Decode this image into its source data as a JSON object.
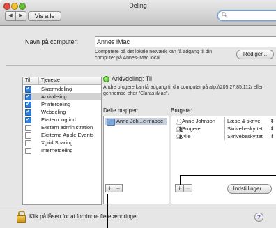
{
  "window": {
    "title": "Deling"
  },
  "toolbar": {
    "back_icon": "◀",
    "forward_icon": "▶",
    "show_all_label": "Vis alle",
    "search_value": ""
  },
  "computer": {
    "name_label": "Navn på computer:",
    "name_value": "Annes iMac",
    "description": "Computere på det lokale netværk kan få adgang til din computer på Annes-iMac.local",
    "edit_button": "Rediger..."
  },
  "services": {
    "header_on": "Til",
    "header_service": "Tjeneste",
    "items": [
      {
        "label": "Skærmdeling",
        "checked": true,
        "selected": false
      },
      {
        "label": "Arkivdeling",
        "checked": true,
        "selected": true
      },
      {
        "label": "Printerdeling",
        "checked": true,
        "selected": false
      },
      {
        "label": "Webdeling",
        "checked": true,
        "selected": false
      },
      {
        "label": "Ekstern log ind",
        "checked": true,
        "selected": false
      },
      {
        "label": "Ekstern administration",
        "checked": false,
        "selected": false
      },
      {
        "label": "Eksterne Apple Events",
        "checked": false,
        "selected": false
      },
      {
        "label": "Xgrid Sharing",
        "checked": false,
        "selected": false
      },
      {
        "label": "Internetdeling",
        "checked": false,
        "selected": false
      }
    ]
  },
  "detail": {
    "status": "Arkivdeling: Til",
    "status_color": "#3eae13",
    "description": "Andre brugere kan få adgang til din computer på afp://205.27.85.112/ eller gennemse efter \"Claras iMac\".",
    "folders_header": "Delte mapper:",
    "users_header": "Brugere:",
    "folders": [
      "Anne Joh...e mappe"
    ],
    "users": [
      {
        "name": "Anne Johnson",
        "permission": "Læse & skrive",
        "icon": "user-icon"
      },
      {
        "name": "Brugere",
        "permission": "Skrivebeskyttet",
        "icon": "group-icon"
      },
      {
        "name": "Alle",
        "permission": "Skrivebeskyttet",
        "icon": "group-icon"
      }
    ],
    "add_label": "+",
    "remove_label": "−",
    "settings_button": "Indstillinger..."
  },
  "footer": {
    "lock_text": "Klik på låsen for at forhindre flere ændringer.",
    "help_label": "?"
  }
}
